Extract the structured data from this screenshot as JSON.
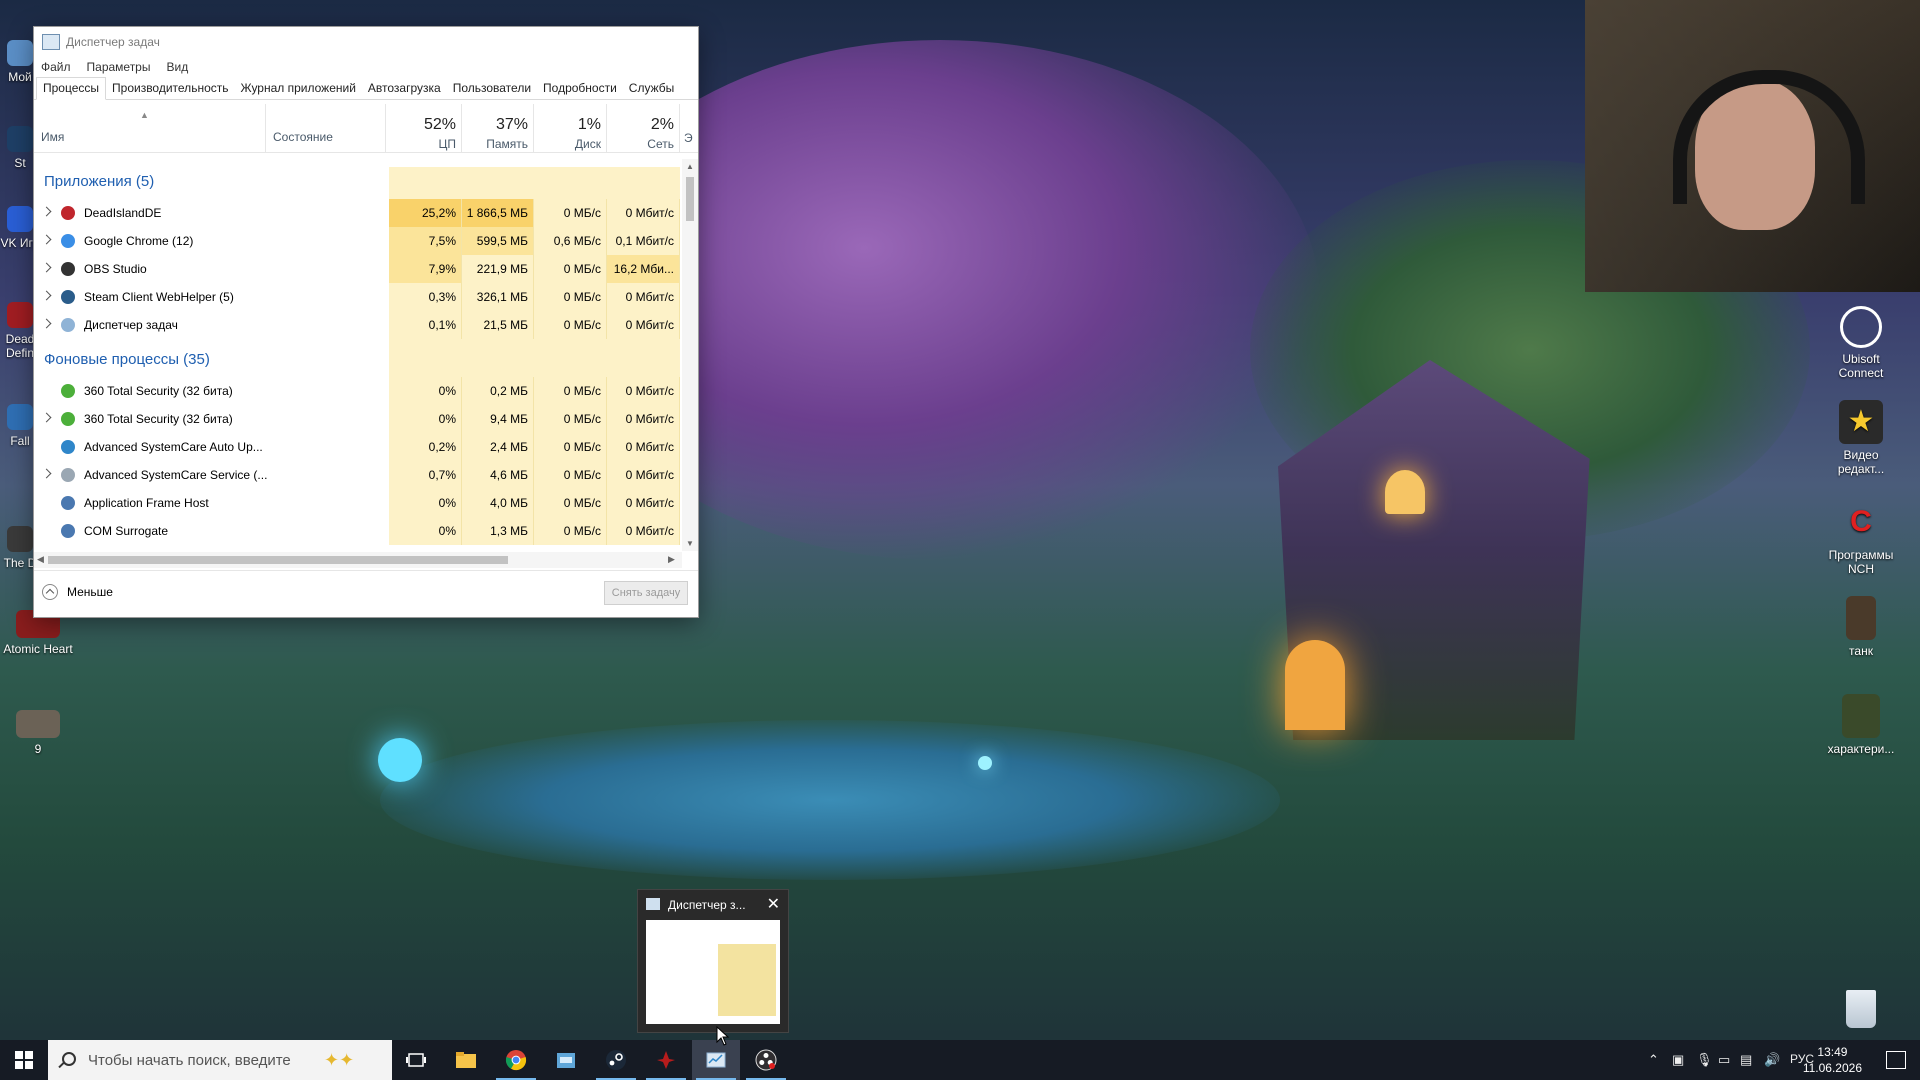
{
  "desktop": {
    "left_icons": [
      {
        "label": "Мой"
      },
      {
        "label": "St"
      },
      {
        "label": "VK Игр"
      },
      {
        "label": "Dead Defin"
      },
      {
        "label": "Fall"
      },
      {
        "label": "The D"
      },
      {
        "label": "Atomic Heart"
      },
      {
        "label": "9"
      }
    ],
    "right_icons": [
      {
        "label": "Ubisoft Connect"
      },
      {
        "label": "Видео редакт..."
      },
      {
        "label": "Программы NCH"
      },
      {
        "label": "танк"
      },
      {
        "label": "характери..."
      }
    ]
  },
  "task_manager": {
    "title": "Диспетчер задач",
    "menu": [
      "Файл",
      "Параметры",
      "Вид"
    ],
    "tabs": [
      "Процессы",
      "Производительность",
      "Журнал приложений",
      "Автозагрузка",
      "Пользователи",
      "Подробности",
      "Службы"
    ],
    "active_tab": "Процессы",
    "columns": {
      "name": "Имя",
      "state": "Состояние",
      "cpu": {
        "pct": "52%",
        "label": "ЦП"
      },
      "mem": {
        "pct": "37%",
        "label": "Память"
      },
      "disk": {
        "pct": "1%",
        "label": "Диск"
      },
      "net": {
        "pct": "2%",
        "label": "Сеть"
      },
      "extra": "Э"
    },
    "groups": {
      "apps": "Приложения (5)",
      "background": "Фоновые процессы (35)"
    },
    "apps": [
      {
        "name": "DeadIslandDE",
        "cpu": "25,2%",
        "mem": "1 866,5 МБ",
        "disk": "0 МБ/с",
        "net": "0 Мбит/с",
        "icon_color": "#c0262d",
        "expand": true
      },
      {
        "name": "Google Chrome (12)",
        "cpu": "7,5%",
        "mem": "599,5 МБ",
        "disk": "0,6 МБ/с",
        "net": "0,1 Мбит/с",
        "icon_color": "#3a8ee6",
        "expand": true
      },
      {
        "name": "OBS Studio",
        "cpu": "7,9%",
        "mem": "221,9 МБ",
        "disk": "0 МБ/с",
        "net": "16,2 Мби...",
        "icon_color": "#333333",
        "expand": true
      },
      {
        "name": "Steam Client WebHelper (5)",
        "cpu": "0,3%",
        "mem": "326,1 МБ",
        "disk": "0 МБ/с",
        "net": "0 Мбит/с",
        "icon_color": "#2a5c8a",
        "expand": true
      },
      {
        "name": "Диспетчер задач",
        "cpu": "0,1%",
        "mem": "21,5 МБ",
        "disk": "0 МБ/с",
        "net": "0 Мбит/с",
        "icon_color": "#8fb3d6",
        "expand": true
      }
    ],
    "background": [
      {
        "name": "360 Total Security (32 бита)",
        "cpu": "0%",
        "mem": "0,2 МБ",
        "disk": "0 МБ/с",
        "net": "0 Мбит/с",
        "icon_color": "#4caf3a",
        "expand": false
      },
      {
        "name": "360 Total Security (32 бита)",
        "cpu": "0%",
        "mem": "9,4 МБ",
        "disk": "0 МБ/с",
        "net": "0 Мбит/с",
        "icon_color": "#4caf3a",
        "expand": true
      },
      {
        "name": "Advanced SystemCare Auto Up...",
        "cpu": "0,2%",
        "mem": "2,4 МБ",
        "disk": "0 МБ/с",
        "net": "0 Мбит/с",
        "icon_color": "#2f86c9",
        "expand": false
      },
      {
        "name": "Advanced SystemCare Service (...",
        "cpu": "0,7%",
        "mem": "4,6 МБ",
        "disk": "0 МБ/с",
        "net": "0 Мбит/с",
        "icon_color": "#9aa7b3",
        "expand": true
      },
      {
        "name": "Application Frame Host",
        "cpu": "0%",
        "mem": "4,0 МБ",
        "disk": "0 МБ/с",
        "net": "0 Мбит/с",
        "icon_color": "#4a78b0",
        "expand": false
      },
      {
        "name": "COM Surrogate",
        "cpu": "0%",
        "mem": "1,3 МБ",
        "disk": "0 МБ/с",
        "net": "0 Мбит/с",
        "icon_color": "#4a78b0",
        "expand": false
      }
    ],
    "footer": {
      "fewer": "Меньше",
      "end_task": "Снять задачу"
    },
    "heat_colors": {
      "high": "#f9d26a",
      "mid": "#fbe49a",
      "low": "#fdf2c8"
    }
  },
  "thumbnail": {
    "title": "Диспетчер з..."
  },
  "taskbar": {
    "search_placeholder": "Чтобы начать поиск, введите",
    "lang": "РУС",
    "time": "13:49",
    "date": "11.06.2026"
  }
}
